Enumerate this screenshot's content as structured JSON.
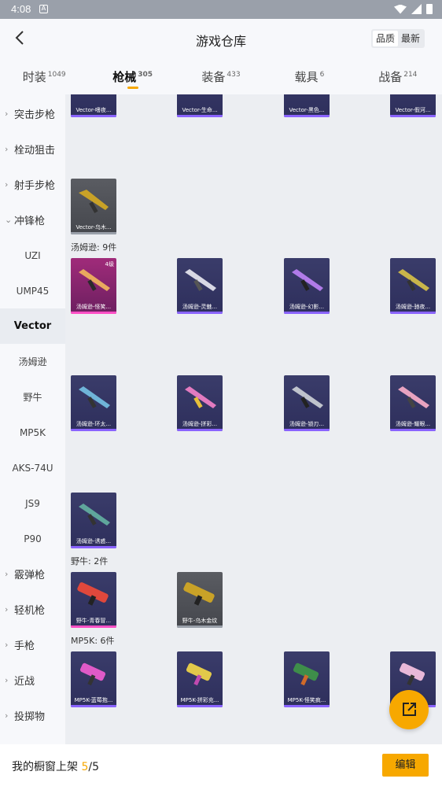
{
  "status": {
    "time": "4:08",
    "notif_letter": "A"
  },
  "header": {
    "title": "游戏仓库",
    "sort_quality": "品质",
    "sort_newest": "最新"
  },
  "tabs": [
    {
      "label": "时装",
      "count": "1049"
    },
    {
      "label": "枪械",
      "count": "305"
    },
    {
      "label": "装备",
      "count": "433"
    },
    {
      "label": "载具",
      "count": "6"
    },
    {
      "label": "战备",
      "count": "214"
    }
  ],
  "sidebar": {
    "items": [
      {
        "label": "突击步枪",
        "kind": "category"
      },
      {
        "label": "栓动狙击",
        "kind": "category"
      },
      {
        "label": "射手步枪",
        "kind": "category"
      },
      {
        "label": "冲锋枪",
        "kind": "category-open"
      },
      {
        "label": "UZI",
        "kind": "sub"
      },
      {
        "label": "UMP45",
        "kind": "sub"
      },
      {
        "label": "Vector",
        "kind": "sub-selected"
      },
      {
        "label": "汤姆逊",
        "kind": "sub"
      },
      {
        "label": "野牛",
        "kind": "sub"
      },
      {
        "label": "MP5K",
        "kind": "sub"
      },
      {
        "label": "AKS-74U",
        "kind": "sub"
      },
      {
        "label": "JS9",
        "kind": "sub"
      },
      {
        "label": "P90",
        "kind": "sub"
      },
      {
        "label": "霰弹枪",
        "kind": "category"
      },
      {
        "label": "轻机枪",
        "kind": "category"
      },
      {
        "label": "手枪",
        "kind": "category"
      },
      {
        "label": "近战",
        "kind": "category"
      },
      {
        "label": "投掷物",
        "kind": "category"
      }
    ]
  },
  "sections": {
    "vector_top": [
      "Vector-嗜夜...",
      "Vector-生命...",
      "Vector-黑色...",
      "Vector-假河..."
    ],
    "vector_more": [
      "Vector-乌木..."
    ],
    "tommy_title": "汤姆逊: 9件",
    "tommy": [
      "汤姆逊-怪笑...",
      "汤姆逊-灵魅...",
      "汤姆逊-幻影...",
      "汤姆逊-驰夜...",
      "汤姆逊-环太...",
      "汤姆逊-拼彩...",
      "汤姆逊-锁刃...",
      "汤姆逊-耀眼...",
      "汤姆逊-诱惑..."
    ],
    "tommy_level": "4级",
    "bizon_title": "野牛: 2件",
    "bizon": [
      "野牛-青春冒...",
      "野牛-乌木金纹"
    ],
    "mp5k_title": "MP5K: 6件",
    "mp5k": [
      "MP5K-蓝莓抱...",
      "MP5K-拼彩充...",
      "MP5K-怪笑疯...",
      "MP5K-..."
    ]
  },
  "bottom": {
    "prefix": "我的橱窗上架 ",
    "current": "5",
    "sep": "/",
    "total": "5",
    "edit": "编辑"
  },
  "colors": {
    "accent": "#f7a800",
    "purple_bar": "#8a63ff",
    "pink_bar": "#ff4fc6"
  }
}
